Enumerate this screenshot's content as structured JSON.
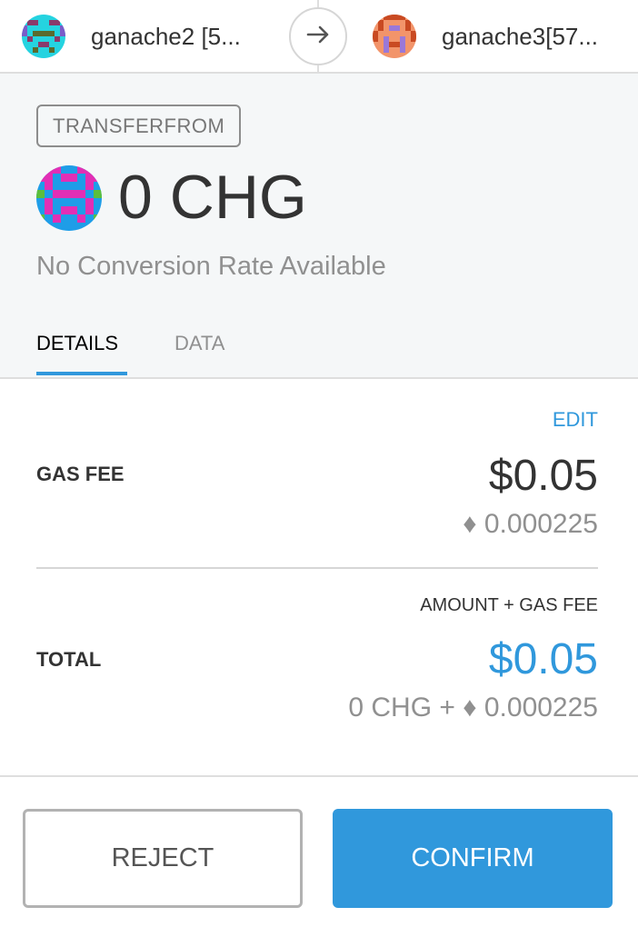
{
  "header": {
    "from_account": {
      "name": "ganache2 [5...",
      "avatar_icon": "identicon-from-icon"
    },
    "to_account": {
      "name": "ganache3[57...",
      "avatar_icon": "identicon-to-icon"
    },
    "arrow_icon": "arrow-right-icon"
  },
  "summary": {
    "method": "TRANSFERFROM",
    "token_icon": "token-identicon-icon",
    "amount": "0 CHG",
    "conversion_rate": "No Conversion Rate Available",
    "tabs": [
      {
        "label": "DETAILS",
        "active": true
      },
      {
        "label": "DATA",
        "active": false
      }
    ]
  },
  "details": {
    "edit_label": "EDIT",
    "gas_fee": {
      "label": "GAS FEE",
      "fiat": "$0.05",
      "eth": "♦ 0.000225"
    },
    "total": {
      "sub_label": "AMOUNT + GAS FEE",
      "label": "TOTAL",
      "fiat": "$0.05",
      "breakdown": "0 CHG + ♦ 0.000225"
    }
  },
  "footer": {
    "reject_label": "REJECT",
    "confirm_label": "CONFIRM"
  },
  "colors": {
    "accent": "#3098dc",
    "summary_bg": "#f5f7f8",
    "muted_text": "#909090"
  }
}
